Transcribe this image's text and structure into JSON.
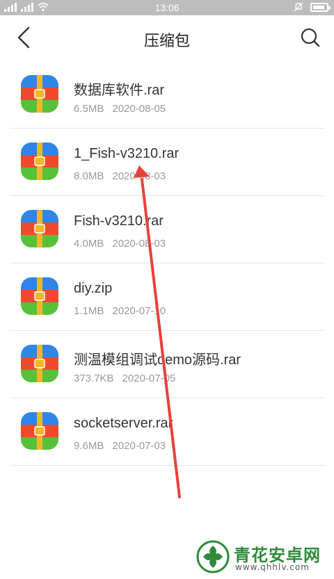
{
  "status_bar": {
    "time": "13:06"
  },
  "header": {
    "title": "压缩包"
  },
  "files": [
    {
      "name": "数据库软件.rar",
      "size": "6.5MB",
      "date": "2020-08-05"
    },
    {
      "name": "1_Fish-v3210.rar",
      "size": "8.0MB",
      "date": "2020-08-03"
    },
    {
      "name": "Fish-v3210.rar",
      "size": "4.0MB",
      "date": "2020-08-03"
    },
    {
      "name": "diy.zip",
      "size": "1.1MB",
      "date": "2020-07-10"
    },
    {
      "name": "测温模组调试demo源码.rar",
      "size": "373.7KB",
      "date": "2020-07-05"
    },
    {
      "name": "socketserver.rar",
      "size": "9.6MB",
      "date": "2020-07-03"
    }
  ],
  "icons": {
    "back": "chevron-left-icon",
    "search": "search-icon",
    "archive": "archive-icon",
    "annotation": "red-arrow-annotation"
  },
  "colors": {
    "status_bar": "#bdbdbd",
    "archive_blue": "#2f86e8",
    "archive_red": "#f04a2e",
    "archive_green": "#57c13a",
    "archive_zip": "#f1b72a",
    "annotation_red": "#e8413c",
    "watermark_green": "#2e8b3a"
  },
  "watermark": {
    "text": "青花安卓网",
    "url": "www.qhhlv.com"
  }
}
